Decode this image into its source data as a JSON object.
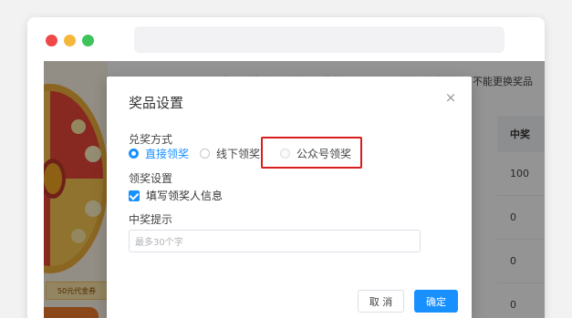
{
  "browser": {
    "dots": [
      "red",
      "yellow",
      "green"
    ],
    "address": ""
  },
  "page": {
    "notice": "奖品列表必须要有一个非奖品，最后一个奖品为非奖品，不能更换奖品",
    "coupon_tag": "50元代金券",
    "table": {
      "header": "中奖",
      "cells": [
        "100",
        "0",
        "0",
        "0"
      ]
    }
  },
  "dialog": {
    "title": "奖品设置",
    "close_icon": "close-icon",
    "redeem_label": "兑奖方式",
    "redeem_options": [
      {
        "label": "直接领奖",
        "checked": true,
        "disabled": false
      },
      {
        "label": "线下领奖",
        "checked": false,
        "disabled": false
      },
      {
        "label": "公众号领奖",
        "checked": false,
        "disabled": true
      }
    ],
    "claim_label": "领奖设置",
    "claim_checkbox_label": "填写领奖人信息",
    "claim_checkbox_checked": true,
    "hint_label": "中奖提示",
    "hint_placeholder": "最多30个字",
    "cancel_label": "取 消",
    "ok_label": "确定"
  },
  "colors": {
    "primary": "#1890ff",
    "highlight": "#d91c1c"
  }
}
